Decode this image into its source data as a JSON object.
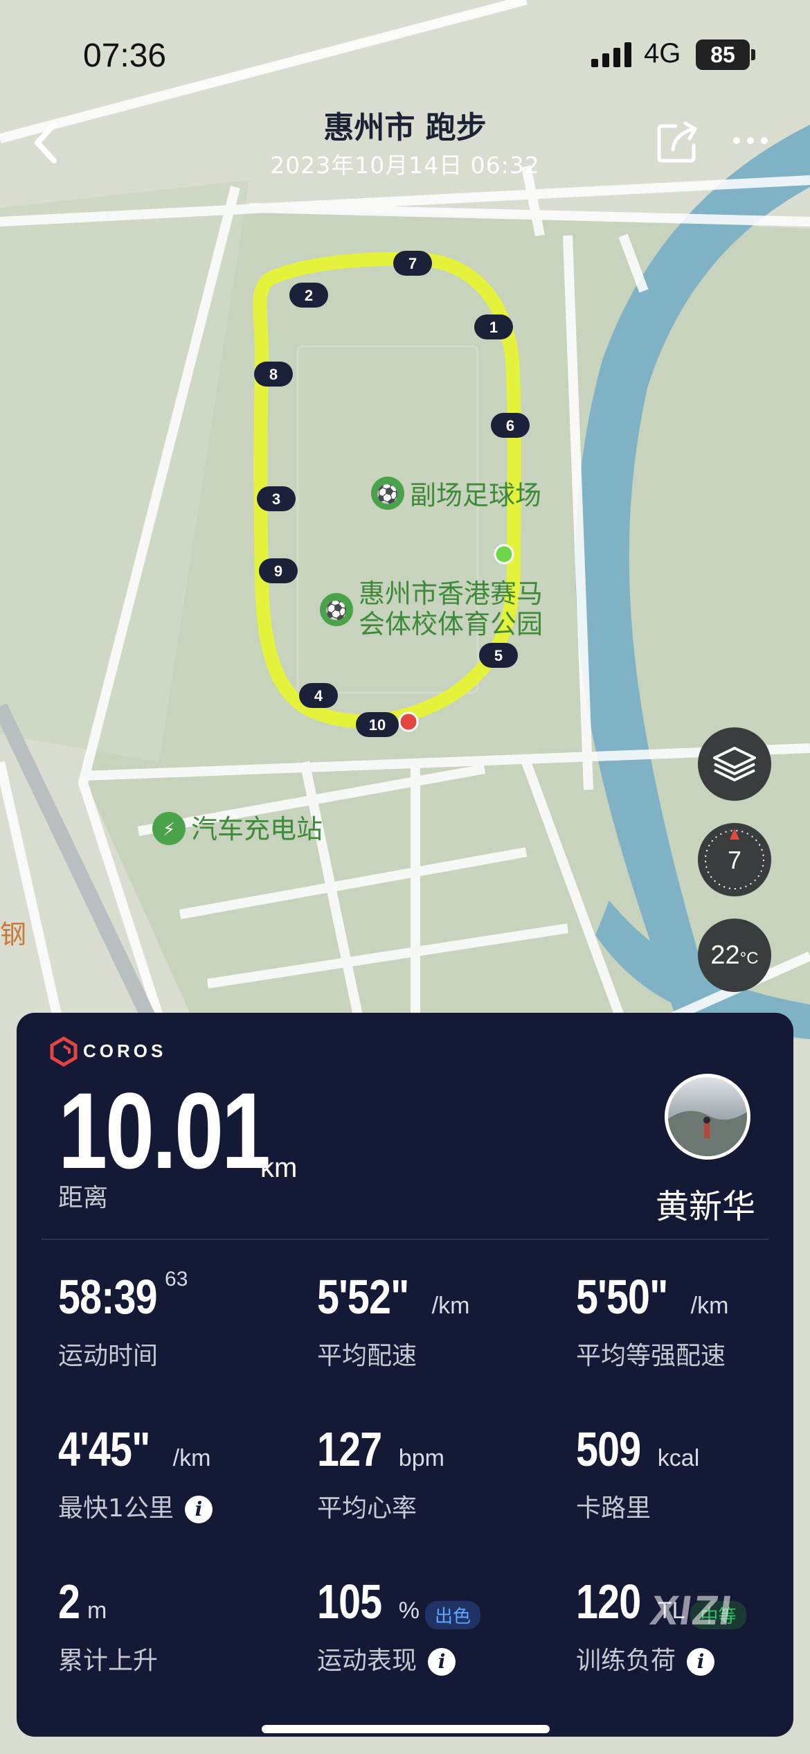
{
  "status_bar": {
    "time": "07:36",
    "network": "4G",
    "battery": "85"
  },
  "header": {
    "title": "惠州市 跑步",
    "subtitle": "2023年10月14日 06:32"
  },
  "map": {
    "poi_1": "副场足球场",
    "poi_2_line1": "惠州市香港赛马",
    "poi_2_line2": "会体校体育公园",
    "poi_3": "汽车充电站",
    "edge_text_1": "钢",
    "km_markers": [
      "7",
      "2",
      "1",
      "8",
      "6",
      "3",
      "9",
      "5",
      "4",
      "10"
    ],
    "route_color": "#e4f23b",
    "start_color": "#6fd64a",
    "end_color": "#e3463f"
  },
  "map_controls": {
    "compass_value": "7",
    "temperature": "22",
    "temp_unit": "°C"
  },
  "card": {
    "brand": "COROS",
    "distance": "10.01",
    "distance_unit": "km",
    "distance_label": "距离",
    "user_name": "黄新华",
    "stats": [
      {
        "value": "58:39",
        "sup": "63",
        "unit": "",
        "label": "运动时间"
      },
      {
        "value": "5'52\"",
        "unit": "/km",
        "label": "平均配速"
      },
      {
        "value": "5'50\"",
        "unit": "/km",
        "label": "平均等强配速"
      },
      {
        "value": "4'45\"",
        "unit": "/km",
        "label": "最快1公里"
      },
      {
        "value": "127",
        "unit": "bpm",
        "label": "平均心率"
      },
      {
        "value": "509",
        "unit": "kcal",
        "label": "卡路里"
      },
      {
        "value": "2",
        "unit": "m",
        "label": "累计上升"
      },
      {
        "value": "105",
        "unit": "%",
        "badge": "出色",
        "label": "运动表现"
      },
      {
        "value": "120",
        "unit": "TL",
        "badge": "中等",
        "label": "训练负荷"
      }
    ]
  },
  "watermark": "XIZI"
}
